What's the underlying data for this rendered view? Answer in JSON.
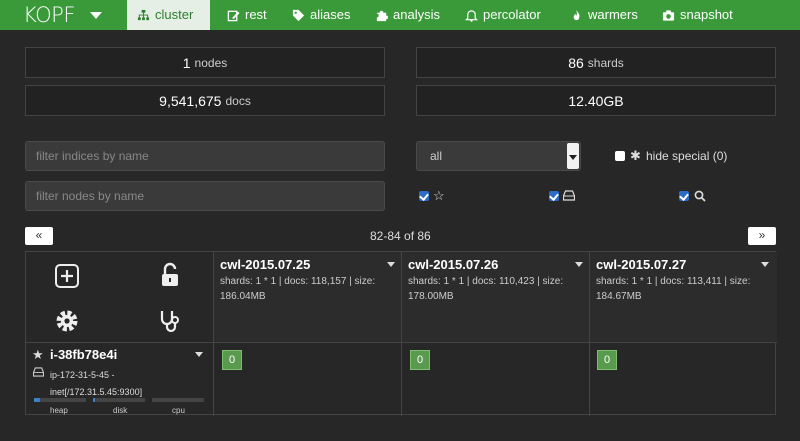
{
  "nav": {
    "brand": "KOPF",
    "items": [
      {
        "label": "cluster",
        "icon": "sitemap-icon",
        "active": true
      },
      {
        "label": "rest",
        "icon": "edit-icon"
      },
      {
        "label": "aliases",
        "icon": "tags-icon"
      },
      {
        "label": "analysis",
        "icon": "puzzle-icon"
      },
      {
        "label": "percolator",
        "icon": "bell-icon"
      },
      {
        "label": "warmers",
        "icon": "fire-icon"
      },
      {
        "label": "snapshot",
        "icon": "camera-icon"
      }
    ]
  },
  "stats": {
    "nodes_value": "1",
    "nodes_label": "nodes",
    "shards_value": "86",
    "shards_label": "shards",
    "docs_value": "9,541,675",
    "docs_label": "docs",
    "size_value": "12.40GB"
  },
  "filters": {
    "indices_placeholder": "filter indices by name",
    "nodes_placeholder": "filter nodes by name",
    "state_selected": "all",
    "hide_special_label": "hide special (0)"
  },
  "pager": {
    "prev": "«",
    "next": "»",
    "summary": "82-84 of 86"
  },
  "indices": [
    {
      "name": "cwl-2015.07.25",
      "info": "shards: 1 * 1 | docs: 118,157 | size: 186.04MB"
    },
    {
      "name": "cwl-2015.07.26",
      "info": "shards: 1 * 1 | docs: 110,423 | size: 178.00MB"
    },
    {
      "name": "cwl-2015.07.27",
      "info": "shards: 1 * 1 | docs: 113,411 | size: 184.67MB"
    }
  ],
  "node": {
    "name": "i-38fb78e4i",
    "host": "ip-172-31-5-45 - inet[/172.31.5.45:9300]",
    "heap_label": "heap",
    "disk_label": "disk",
    "cpu_label": "cpu",
    "heap_fraction": 0.12,
    "disk_fraction": 0.03,
    "cpu_fraction": 0.0,
    "shards": [
      "0",
      "0",
      "0"
    ]
  },
  "colors": {
    "nav": "#3a9a3a",
    "shard": "#5a9a4e",
    "bar": "#3c7fc8"
  }
}
